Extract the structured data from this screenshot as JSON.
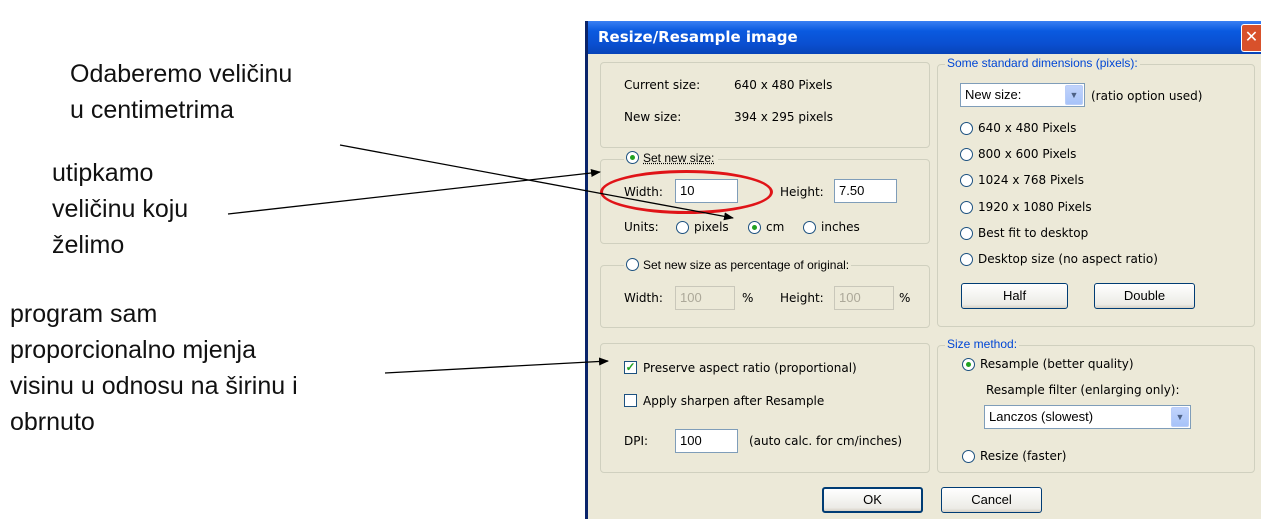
{
  "annotations": {
    "note1": [
      "Odaberemo veličinu",
      "u centimetrima"
    ],
    "note2": [
      "utipkamo",
      "veličinu koju",
      "želimo"
    ],
    "note3": [
      "program sam",
      "proporcionalno mjenja",
      "visinu u odnosu na širinu i",
      "obrnuto"
    ]
  },
  "dialog": {
    "title": "Resize/Resample image",
    "close_glyph": "✕",
    "current_size_label": "Current size:",
    "current_size_value": "640  x  480  Pixels",
    "new_size_label": "New size:",
    "new_size_value": "394  x  295  pixels",
    "set_new_size": {
      "label": "Set new size:",
      "selected": true,
      "width_label": "Width:",
      "width_value": "10",
      "height_label": "Height:",
      "height_value": "7.50",
      "units_label": "Units:",
      "units": [
        "pixels",
        "cm",
        "inches"
      ],
      "selected_unit": "cm"
    },
    "percentage": {
      "label": "Set new size as percentage of original:",
      "width_label": "Width:",
      "width_value": "100",
      "height_label": "Height:",
      "height_value": "100",
      "percent_sign": "%"
    },
    "preserve_aspect": {
      "label": "Preserve aspect ratio (proportional)",
      "checked": true
    },
    "apply_sharpen": {
      "label": "Apply sharpen after Resample",
      "checked": false
    },
    "dpi": {
      "label": "DPI:",
      "value": "100",
      "hint": "(auto calc. for cm/inches)"
    },
    "standard_dims": {
      "legend": "Some standard dimensions (pixels):",
      "select_value": "New size:",
      "select_hint": "(ratio option used)",
      "options": [
        "640 x 480 Pixels",
        "800 x 600 Pixels",
        "1024 x 768 Pixels",
        "1920 x 1080 Pixels",
        "Best fit to desktop",
        "Desktop size (no aspect ratio)"
      ],
      "half_label": "Half",
      "double_label": "Double"
    },
    "size_method": {
      "legend": "Size method:",
      "resample_label": "Resample (better quality)",
      "resample_selected": true,
      "filter_label": "Resample filter (enlarging only):",
      "filter_value": "Lanczos (slowest)",
      "resize_label": "Resize (faster)"
    },
    "ok_label": "OK",
    "cancel_label": "Cancel",
    "colors": {
      "title_bar": "#0A4FD0",
      "face": "#ECE9D8",
      "highlight_ellipse": "#E01418",
      "group_legend": "#0046D5"
    }
  }
}
